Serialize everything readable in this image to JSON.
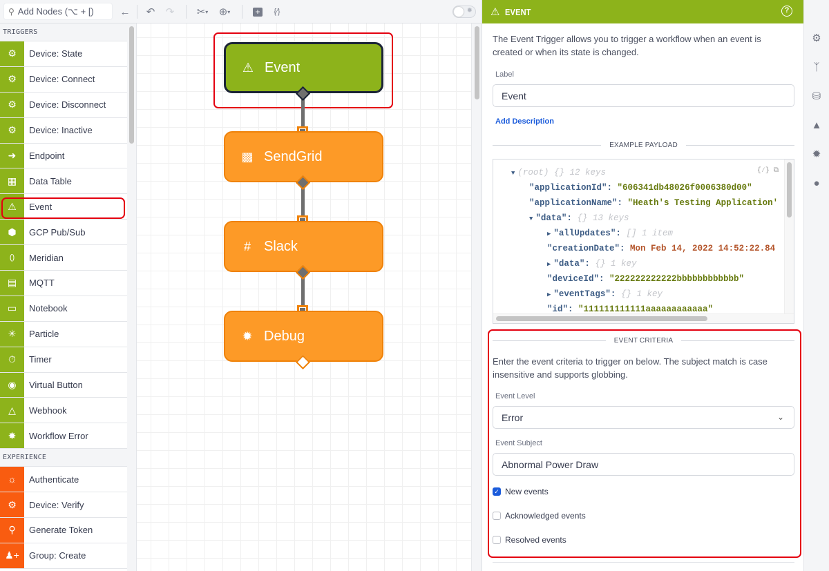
{
  "toolbar": {
    "search_placeholder": "Add Nodes (⌥ + [)",
    "icons": [
      "search-icon",
      "back-arrow-icon",
      "undo-icon",
      "redo-icon",
      "scissors-icon",
      "zoom-icon",
      "add-comment-icon",
      "template-icon",
      "debug-toggle"
    ]
  },
  "sidebar": {
    "sections": [
      {
        "title": "TRIGGERS",
        "items": [
          {
            "label": "Device: State",
            "icon": "chip-icon"
          },
          {
            "label": "Device: Connect",
            "icon": "chip-connect-icon"
          },
          {
            "label": "Device: Disconnect",
            "icon": "chip-disconnect-icon"
          },
          {
            "label": "Device: Inactive",
            "icon": "chip-inactive-icon"
          },
          {
            "label": "Endpoint",
            "icon": "endpoint-icon"
          },
          {
            "label": "Data Table",
            "icon": "table-icon"
          },
          {
            "label": "Event",
            "icon": "warning-icon"
          },
          {
            "label": "GCP Pub/Sub",
            "icon": "gcp-icon"
          },
          {
            "label": "Meridian",
            "icon": "meridian-icon"
          },
          {
            "label": "MQTT",
            "icon": "mqtt-icon"
          },
          {
            "label": "Notebook",
            "icon": "notebook-icon"
          },
          {
            "label": "Particle",
            "icon": "particle-icon"
          },
          {
            "label": "Timer",
            "icon": "timer-icon"
          },
          {
            "label": "Virtual Button",
            "icon": "button-icon"
          },
          {
            "label": "Webhook",
            "icon": "webhook-icon"
          },
          {
            "label": "Workflow Error",
            "icon": "workflow-error-icon"
          }
        ]
      },
      {
        "title": "EXPERIENCE",
        "items": [
          {
            "label": "Authenticate",
            "icon": "fingerprint-icon"
          },
          {
            "label": "Device: Verify",
            "icon": "chip-verify-icon"
          },
          {
            "label": "Generate Token",
            "icon": "key-icon"
          },
          {
            "label": "Group: Create",
            "icon": "add-group-icon"
          }
        ]
      }
    ]
  },
  "canvas": {
    "nodes": [
      {
        "label": "Event",
        "type": "trigger",
        "icon": "warning-icon",
        "selected": true
      },
      {
        "label": "SendGrid",
        "type": "output",
        "icon": "sendgrid-icon"
      },
      {
        "label": "Slack",
        "type": "output",
        "icon": "slack-icon"
      },
      {
        "label": "Debug",
        "type": "output",
        "icon": "bug-icon"
      }
    ]
  },
  "panel": {
    "title": "EVENT",
    "description": "The Event Trigger allows you to trigger a workflow when an event is created or when its state is changed.",
    "label_field": {
      "label": "Label",
      "value": "Event"
    },
    "add_description": "Add Description",
    "example_payload_title": "EXAMPLE PAYLOAD",
    "payload": {
      "root": "(root)",
      "root_meta": "{}  12 keys",
      "lines": [
        {
          "key": "\"applicationId\":",
          "value": "\"606341db48026f0006380d00\""
        },
        {
          "key": "\"applicationName\":",
          "value": "\"Heath's Testing Application'"
        },
        {
          "key": "\"data\":",
          "meta": "{}  13 keys"
        },
        {
          "key": "\"allUpdates\":",
          "meta": "[]  1 item"
        },
        {
          "key": "\"creationDate\":",
          "value": "Mon Feb 14, 2022 14:52:22.84"
        },
        {
          "key": "\"data\":",
          "meta": "{}  1 key"
        },
        {
          "key": "\"deviceId\":",
          "value": "\"222222222222bbbbbbbbbbbb\""
        },
        {
          "key": "\"eventTags\":",
          "meta": "{}  1 key"
        },
        {
          "key": "\"id\":",
          "value": "\"111111111111aaaaaaaaaaaa\""
        }
      ]
    },
    "criteria": {
      "title": "EVENT CRITERIA",
      "description": "Enter the event criteria to trigger on below. The subject match is case insensitive and supports globbing.",
      "level_label": "Event Level",
      "level_value": "Error",
      "subject_label": "Event Subject",
      "subject_value": "Abnormal Power Draw",
      "checkboxes": [
        {
          "label": "New events",
          "checked": true
        },
        {
          "label": "Acknowledged events",
          "checked": false
        },
        {
          "label": "Resolved events",
          "checked": false
        }
      ]
    }
  },
  "rail": {
    "icons": [
      "gear-icon",
      "branch-icon",
      "database-icon",
      "chart-icon",
      "bug-icon",
      "globe-icon"
    ]
  },
  "colors": {
    "trigger_green": "#8db31b",
    "output_orange": "#fd9a27",
    "experience_orange": "#f95c10",
    "highlight_red": "#e4000f",
    "link_blue": "#1a5bdb"
  }
}
